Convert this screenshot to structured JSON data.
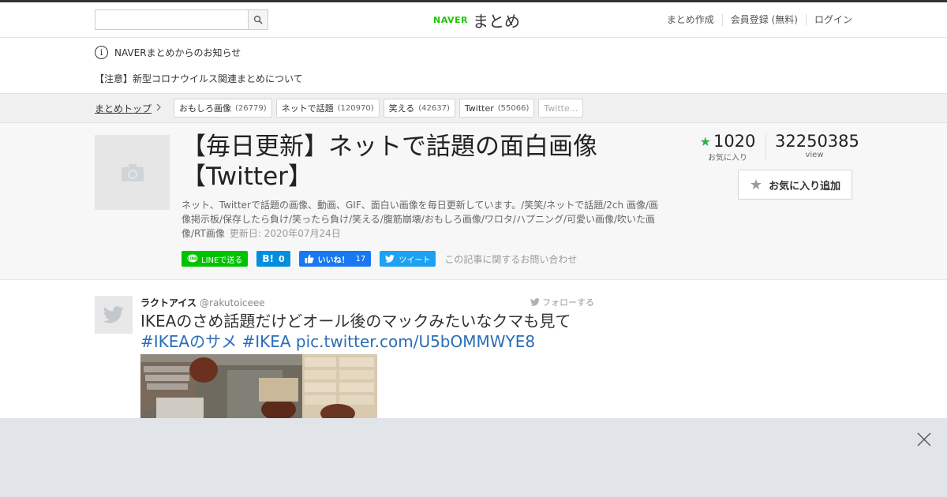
{
  "header": {
    "search": {
      "value": "",
      "placeholder": ""
    },
    "logo": {
      "naver": "NAVER",
      "matome": "まとめ"
    },
    "links": [
      "まとめ作成",
      "会員登録 (無料)",
      "ログイン"
    ]
  },
  "notices": {
    "title": "NAVERまとめからのお知らせ",
    "item": "【注意】新型コロナウイルス関連まとめについて"
  },
  "breadcrumb": {
    "top": "まとめトップ",
    "tags": [
      {
        "label": "おもしろ画像",
        "count": "(26779)"
      },
      {
        "label": "ネットで話題",
        "count": "(120970)"
      },
      {
        "label": "笑える",
        "count": "(42637)"
      },
      {
        "label": "Twitter",
        "count": "(55066)"
      },
      {
        "label": "Twitte...",
        "count": ""
      }
    ]
  },
  "article": {
    "title_line1": "【毎日更新】ネットで話題の面白画像",
    "title_line2": "【Twitter】",
    "description": "ネット、Twitterで話題の画像、動画、GIF、面白い画像を毎日更新しています。/笑笑/ネットで話題/2ch 画像/画像掲示板/保存したら負け/笑ったら負け/笑える/腹筋崩壊/おもしろ画像/ワロタ/ハプニング/可愛い画像/吹いた画像/RT画像",
    "updated": "更新日: 2020年07月24日",
    "favorites": "1020",
    "favorites_label": "お気に入り",
    "views": "32250385",
    "views_label": "view",
    "fav_button": "お気に入り追加",
    "inquiry": "この記事に関するお問い合わせ"
  },
  "share": {
    "line": "LINEで送る",
    "hatena_count": "0",
    "fb_label": "いいね！",
    "fb_count": "17",
    "tweet": "ツイート"
  },
  "tweet": {
    "name": "ラクトアイス",
    "handle": "@rakutoiceee",
    "follow": "フォローする",
    "text": "IKEAのさめ話題だけどオール後のマックみたいなクマも見て",
    "links": "#IKEAのサメ #IKEA pic.twitter.com/U5bOMMWYE8"
  },
  "colors": {
    "naver_green": "#1ec800",
    "star_green": "#2fb04a",
    "line": "#00c300",
    "hatena": "#008fde",
    "facebook": "#1877f2",
    "twitter": "#1da1f2",
    "link": "#2a6db7"
  },
  "icons": [
    "search-icon",
    "info-icon",
    "chevron-right-icon",
    "camera-icon",
    "star-icon",
    "twitter-bird-icon",
    "close-icon"
  ]
}
